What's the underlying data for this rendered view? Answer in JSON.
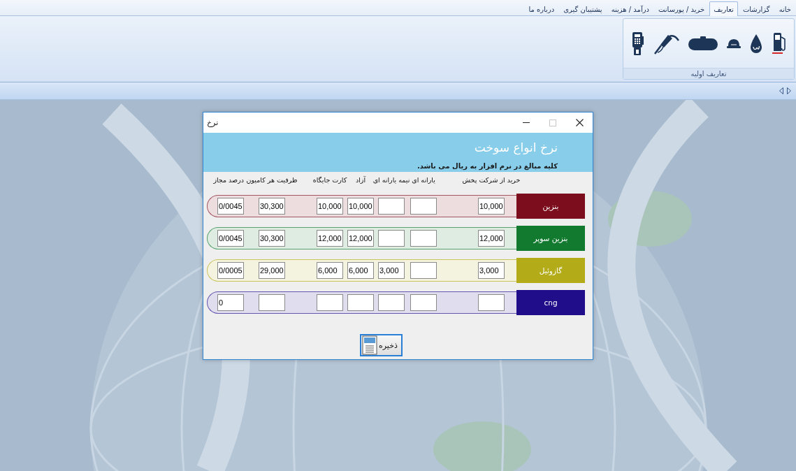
{
  "menu_tabs": [
    {
      "label": "خانه",
      "selected": false
    },
    {
      "label": "گزارشات",
      "selected": false
    },
    {
      "label": "تعاریف",
      "selected": true
    },
    {
      "label": "خرید / پورسانت",
      "selected": false
    },
    {
      "label": "درآمد / هزینه",
      "selected": false
    },
    {
      "label": "پشتیبان گیری",
      "selected": false
    },
    {
      "label": "درباره ما",
      "selected": false
    }
  ],
  "ribbon_group": {
    "label": "تعاریف اولیه"
  },
  "dialog": {
    "title": "نرخ",
    "maximize_disabled": true,
    "heading": "نرخ انواع سوخت",
    "note": "کلیه مبالغ در نرم افزار به ریال می باشد.",
    "columns": [
      "خرید از شرکت پخش",
      "یارانه ای",
      "نیمه یارانه ای",
      "آزاد",
      "کارت جایگاه",
      "ظرفیت هر کامیون",
      "درصد مجاز"
    ],
    "rows": [
      {
        "name": "بنزین",
        "color": "#7b0d1d",
        "fields": {
          "purchase": "10,000",
          "free": "10,000",
          "station_card": "10,000",
          "truck_capacity": "30,300",
          "allowed_percent": "0/0045"
        }
      },
      {
        "name": "بنزین سوپر",
        "color": "#117a2f",
        "fields": {
          "purchase": "12,000",
          "free": "12,000",
          "station_card": "12,000",
          "truck_capacity": "30,300",
          "allowed_percent": "0/0045"
        }
      },
      {
        "name": "گازوئیل",
        "color": "#b3ab17",
        "fields": {
          "purchase": "3,000",
          "semi_subsidized": "3,000",
          "free": "6,000",
          "station_card": "6,000",
          "truck_capacity": "29,000",
          "allowed_percent": "0/0005"
        }
      },
      {
        "name": "cng",
        "color": "#1f0d8a",
        "fields": {
          "allowed_percent": "0"
        }
      }
    ],
    "save_button": {
      "label": "ذخیره"
    }
  }
}
